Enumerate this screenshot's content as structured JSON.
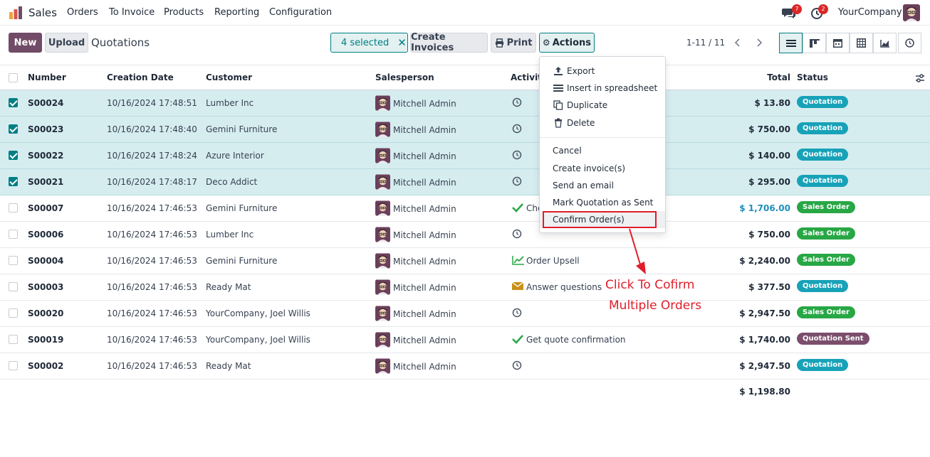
{
  "topbar": {
    "app_name": "Sales",
    "nav": [
      "Orders",
      "To Invoice",
      "Products",
      "Reporting",
      "Configuration"
    ],
    "chat_badge": "7",
    "activity_badge": "2",
    "company": "YourCompany"
  },
  "control": {
    "new_label": "New",
    "upload_label": "Upload",
    "page_title": "Quotations",
    "selected_label": "4 selected",
    "create_invoices_label": "Create Invoices",
    "print_label": "Print",
    "actions_label": "Actions",
    "pager": "1-11 / 11"
  },
  "columns": {
    "number": "Number",
    "creation_date": "Creation Date",
    "customer": "Customer",
    "salesperson": "Salesperson",
    "activities": "Activiti",
    "total": "Total",
    "status": "Status"
  },
  "rows": [
    {
      "number": "S00024",
      "date": "10/16/2024 17:48:51",
      "customer": "Lumber Inc",
      "salesperson": "Mitchell Admin",
      "activity": "",
      "total": "$ 13.80",
      "status": "Quotation"
    },
    {
      "number": "S00023",
      "date": "10/16/2024 17:48:40",
      "customer": "Gemini Furniture",
      "salesperson": "Mitchell Admin",
      "activity": "",
      "total": "$ 750.00",
      "status": "Quotation"
    },
    {
      "number": "S00022",
      "date": "10/16/2024 17:48:24",
      "customer": "Azure Interior",
      "salesperson": "Mitchell Admin",
      "activity": "",
      "total": "$ 140.00",
      "status": "Quotation"
    },
    {
      "number": "S00021",
      "date": "10/16/2024 17:48:17",
      "customer": "Deco Addict",
      "salesperson": "Mitchell Admin",
      "activity": "",
      "total": "$ 295.00",
      "status": "Quotation"
    },
    {
      "number": "S00007",
      "date": "10/16/2024 17:46:53",
      "customer": "Gemini Furniture",
      "salesperson": "Mitchell Admin",
      "activity": "Che",
      "total": "$ 1,706.00",
      "status": "Sales Order"
    },
    {
      "number": "S00006",
      "date": "10/16/2024 17:46:53",
      "customer": "Lumber Inc",
      "salesperson": "Mitchell Admin",
      "activity": "",
      "total": "$ 750.00",
      "status": "Sales Order"
    },
    {
      "number": "S00004",
      "date": "10/16/2024 17:46:53",
      "customer": "Gemini Furniture",
      "salesperson": "Mitchell Admin",
      "activity": "Order Upsell",
      "total": "$ 2,240.00",
      "status": "Sales Order"
    },
    {
      "number": "S00003",
      "date": "10/16/2024 17:46:53",
      "customer": "Ready Mat",
      "salesperson": "Mitchell Admin",
      "activity": "Answer questions",
      "total": "$ 377.50",
      "status": "Quotation"
    },
    {
      "number": "S00020",
      "date": "10/16/2024 17:46:53",
      "customer": "YourCompany, Joel Willis",
      "salesperson": "Mitchell Admin",
      "activity": "",
      "total": "$ 2,947.50",
      "status": "Sales Order"
    },
    {
      "number": "S00019",
      "date": "10/16/2024 17:46:53",
      "customer": "YourCompany, Joel Willis",
      "salesperson": "Mitchell Admin",
      "activity": "Get quote confirmation",
      "total": "$ 1,740.00",
      "status": "Quotation Sent"
    },
    {
      "number": "S00002",
      "date": "10/16/2024 17:46:53",
      "customer": "Ready Mat",
      "salesperson": "Mitchell Admin",
      "activity": "",
      "total": "$ 2,947.50",
      "status": "Quotation"
    }
  ],
  "footer_total": "$ 1,198.80",
  "actions_menu": {
    "export": "Export",
    "insert_spreadsheet": "Insert in spreadsheet",
    "duplicate": "Duplicate",
    "delete": "Delete",
    "cancel": "Cancel",
    "create_invoices": "Create invoice(s)",
    "send_email": "Send an email",
    "mark_sent": "Mark Quotation as Sent",
    "confirm_orders": "Confirm Order(s)"
  },
  "annotation": {
    "line1": "Click To Cofirm",
    "line2": "Multiple Orders"
  },
  "colors": {
    "brand": "#714b67",
    "accent": "#017e84",
    "selected_row": "#d6edf0",
    "quotation_badge": "#17a2b8",
    "sales_order_badge": "#28a745",
    "quotation_sent_badge": "#7b4e6c",
    "annotation": "#e11d2a"
  }
}
